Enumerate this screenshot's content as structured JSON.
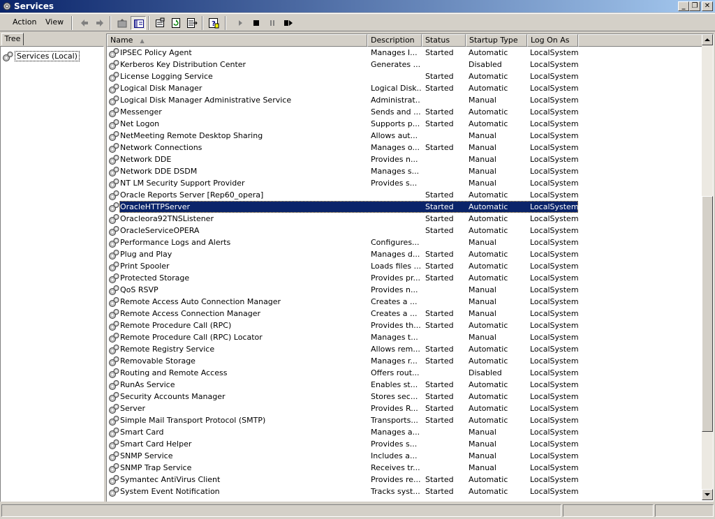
{
  "window": {
    "title": "Services"
  },
  "menu": {
    "action": "Action",
    "view": "View"
  },
  "icons": [
    "back-arrow-icon",
    "forward-arrow-icon",
    "up-folder-icon",
    "show-hide-tree-icon",
    "properties-icon",
    "refresh-icon",
    "export-list-icon",
    "help-icon",
    "play-icon",
    "stop-icon",
    "pause-icon",
    "restart-icon",
    "gear-icon"
  ],
  "tree": {
    "tab_label": "Tree",
    "root_label": "Services (Local)"
  },
  "columns": [
    "Name",
    "Description",
    "Status",
    "Startup Type",
    "Log On As"
  ],
  "selected_service": "OracleHTTPServer",
  "colors": {
    "selection": "#0a246a",
    "title_start": "#0a246a",
    "title_end": "#a6caf0",
    "face": "#d4d0c8"
  },
  "services": [
    {
      "name": "IPSEC Policy Agent",
      "description": "Manages I...",
      "status": "Started",
      "startup": "Automatic",
      "logon": "LocalSystem"
    },
    {
      "name": "Kerberos Key Distribution Center",
      "description": "Generates ...",
      "status": "",
      "startup": "Disabled",
      "logon": "LocalSystem"
    },
    {
      "name": "License Logging Service",
      "description": "",
      "status": "Started",
      "startup": "Automatic",
      "logon": "LocalSystem"
    },
    {
      "name": "Logical Disk Manager",
      "description": "Logical Disk...",
      "status": "Started",
      "startup": "Automatic",
      "logon": "LocalSystem"
    },
    {
      "name": "Logical Disk Manager Administrative Service",
      "description": "Administrat...",
      "status": "",
      "startup": "Manual",
      "logon": "LocalSystem"
    },
    {
      "name": "Messenger",
      "description": "Sends and ...",
      "status": "Started",
      "startup": "Automatic",
      "logon": "LocalSystem"
    },
    {
      "name": "Net Logon",
      "description": "Supports p...",
      "status": "Started",
      "startup": "Automatic",
      "logon": "LocalSystem"
    },
    {
      "name": "NetMeeting Remote Desktop Sharing",
      "description": "Allows aut...",
      "status": "",
      "startup": "Manual",
      "logon": "LocalSystem"
    },
    {
      "name": "Network Connections",
      "description": "Manages o...",
      "status": "Started",
      "startup": "Manual",
      "logon": "LocalSystem"
    },
    {
      "name": "Network DDE",
      "description": "Provides n...",
      "status": "",
      "startup": "Manual",
      "logon": "LocalSystem"
    },
    {
      "name": "Network DDE DSDM",
      "description": "Manages s...",
      "status": "",
      "startup": "Manual",
      "logon": "LocalSystem"
    },
    {
      "name": "NT LM Security Support Provider",
      "description": "Provides s...",
      "status": "",
      "startup": "Manual",
      "logon": "LocalSystem"
    },
    {
      "name": "Oracle Reports Server [Rep60_opera]",
      "description": "",
      "status": "Started",
      "startup": "Automatic",
      "logon": "LocalSystem"
    },
    {
      "name": "OracleHTTPServer",
      "description": "",
      "status": "Started",
      "startup": "Automatic",
      "logon": "LocalSystem"
    },
    {
      "name": "Oracleora92TNSListener",
      "description": "",
      "status": "Started",
      "startup": "Automatic",
      "logon": "LocalSystem"
    },
    {
      "name": "OracleServiceOPERA",
      "description": "",
      "status": "Started",
      "startup": "Automatic",
      "logon": "LocalSystem"
    },
    {
      "name": "Performance Logs and Alerts",
      "description": "Configures...",
      "status": "",
      "startup": "Manual",
      "logon": "LocalSystem"
    },
    {
      "name": "Plug and Play",
      "description": "Manages d...",
      "status": "Started",
      "startup": "Automatic",
      "logon": "LocalSystem"
    },
    {
      "name": "Print Spooler",
      "description": "Loads files ...",
      "status": "Started",
      "startup": "Automatic",
      "logon": "LocalSystem"
    },
    {
      "name": "Protected Storage",
      "description": "Provides pr...",
      "status": "Started",
      "startup": "Automatic",
      "logon": "LocalSystem"
    },
    {
      "name": "QoS RSVP",
      "description": "Provides n...",
      "status": "",
      "startup": "Manual",
      "logon": "LocalSystem"
    },
    {
      "name": "Remote Access Auto Connection Manager",
      "description": "Creates a ...",
      "status": "",
      "startup": "Manual",
      "logon": "LocalSystem"
    },
    {
      "name": "Remote Access Connection Manager",
      "description": "Creates a ...",
      "status": "Started",
      "startup": "Manual",
      "logon": "LocalSystem"
    },
    {
      "name": "Remote Procedure Call (RPC)",
      "description": "Provides th...",
      "status": "Started",
      "startup": "Automatic",
      "logon": "LocalSystem"
    },
    {
      "name": "Remote Procedure Call (RPC) Locator",
      "description": "Manages t...",
      "status": "",
      "startup": "Manual",
      "logon": "LocalSystem"
    },
    {
      "name": "Remote Registry Service",
      "description": "Allows rem...",
      "status": "Started",
      "startup": "Automatic",
      "logon": "LocalSystem"
    },
    {
      "name": "Removable Storage",
      "description": "Manages r...",
      "status": "Started",
      "startup": "Automatic",
      "logon": "LocalSystem"
    },
    {
      "name": "Routing and Remote Access",
      "description": "Offers rout...",
      "status": "",
      "startup": "Disabled",
      "logon": "LocalSystem"
    },
    {
      "name": "RunAs Service",
      "description": "Enables st...",
      "status": "Started",
      "startup": "Automatic",
      "logon": "LocalSystem"
    },
    {
      "name": "Security Accounts Manager",
      "description": "Stores sec...",
      "status": "Started",
      "startup": "Automatic",
      "logon": "LocalSystem"
    },
    {
      "name": "Server",
      "description": "Provides R...",
      "status": "Started",
      "startup": "Automatic",
      "logon": "LocalSystem"
    },
    {
      "name": "Simple Mail Transport Protocol (SMTP)",
      "description": "Transports...",
      "status": "Started",
      "startup": "Automatic",
      "logon": "LocalSystem"
    },
    {
      "name": "Smart Card",
      "description": "Manages a...",
      "status": "",
      "startup": "Manual",
      "logon": "LocalSystem"
    },
    {
      "name": "Smart Card Helper",
      "description": "Provides s...",
      "status": "",
      "startup": "Manual",
      "logon": "LocalSystem"
    },
    {
      "name": "SNMP Service",
      "description": "Includes a...",
      "status": "",
      "startup": "Manual",
      "logon": "LocalSystem"
    },
    {
      "name": "SNMP Trap Service",
      "description": "Receives tr...",
      "status": "",
      "startup": "Manual",
      "logon": "LocalSystem"
    },
    {
      "name": "Symantec AntiVirus Client",
      "description": "Provides re...",
      "status": "Started",
      "startup": "Automatic",
      "logon": "LocalSystem"
    },
    {
      "name": "System Event Notification",
      "description": "Tracks syst...",
      "status": "Started",
      "startup": "Automatic",
      "logon": "LocalSystem"
    }
  ]
}
